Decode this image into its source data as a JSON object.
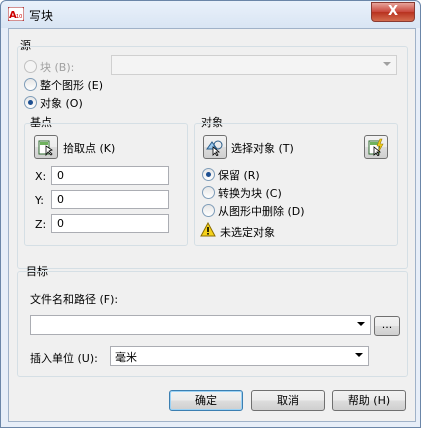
{
  "window": {
    "title": "写块",
    "close_glyph": "X"
  },
  "source": {
    "group_label": "源",
    "block_label": "块 (B):",
    "entire_drawing_label": "整个图形 (E)",
    "objects_label": "对象 (O)",
    "selected": "objects"
  },
  "base_point": {
    "group_label": "基点",
    "pick_label": "拾取点 (K)",
    "x_label": "X:",
    "x_value": "0",
    "y_label": "Y:",
    "y_value": "0",
    "z_label": "Z:",
    "z_value": "0"
  },
  "objects": {
    "group_label": "对象",
    "select_label": "选择对象 (T)",
    "retain_label": "保留 (R)",
    "convert_label": "转换为块 (C)",
    "delete_label": "从图形中删除 (D)",
    "selected": "retain",
    "warning_text": "未选定对象"
  },
  "destination": {
    "group_label": "目标",
    "filename_label": "文件名和路径 (F):",
    "filename_value": "",
    "browse_label": "...",
    "units_label": "插入单位 (U):",
    "units_value": "毫米"
  },
  "buttons": {
    "ok": "确定",
    "cancel": "取消",
    "help": "帮助 (H)"
  },
  "colors": {
    "accent": "#1d4f91",
    "close_red": "#c8463a",
    "warning_yellow": "#f5d21b"
  }
}
